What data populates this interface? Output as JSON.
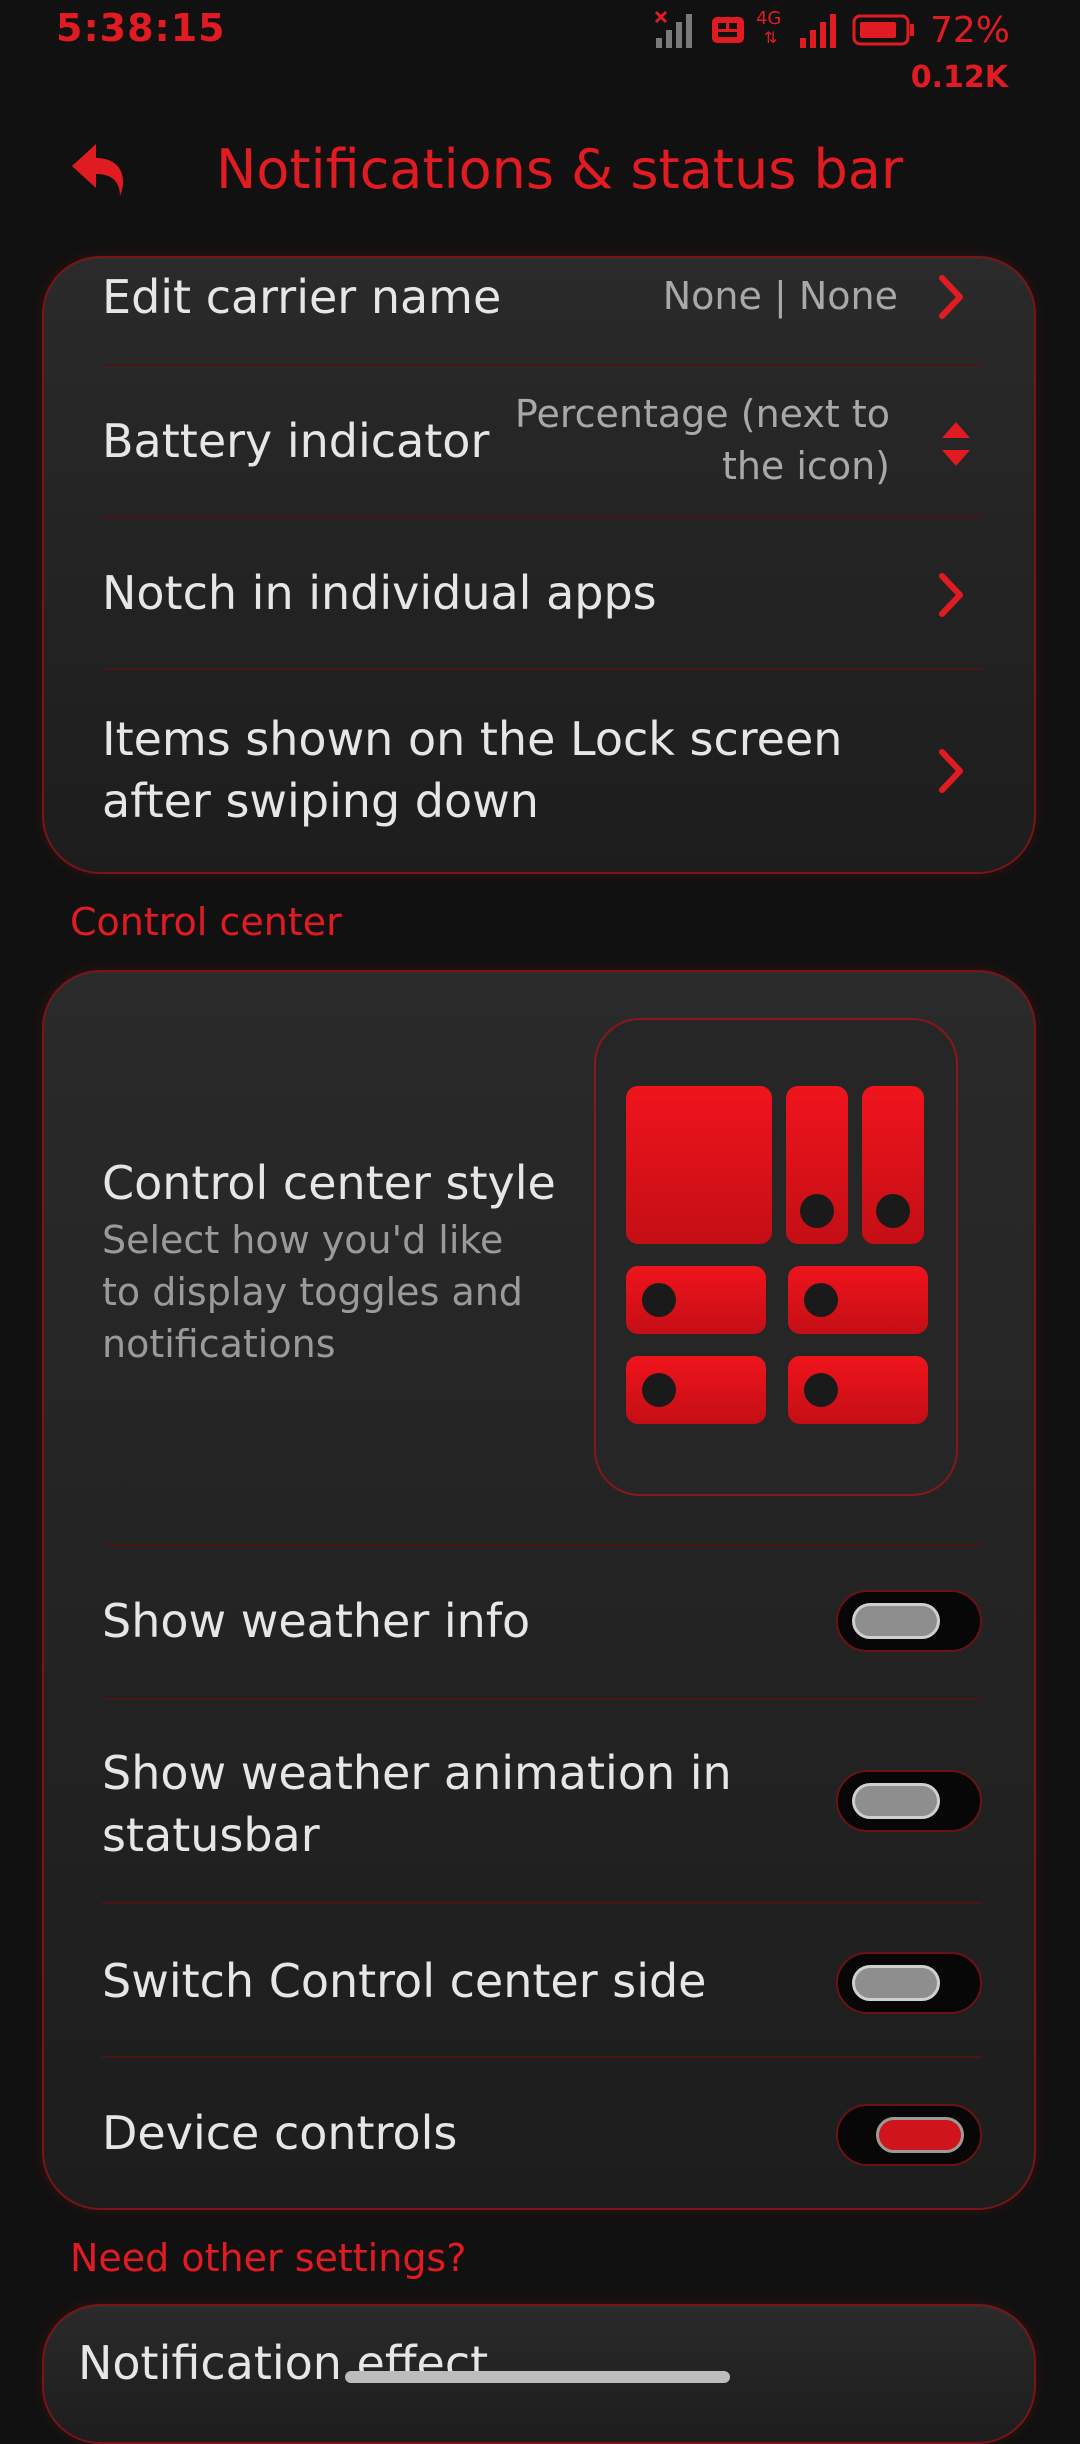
{
  "status_bar": {
    "time": "5:38:15",
    "battery_percent": "72%",
    "network_speed": "0.12K",
    "network_type": "4G"
  },
  "header": {
    "title": "Notifications & status bar"
  },
  "status_card": {
    "items": [
      {
        "label": "Edit carrier name",
        "value": "None | None",
        "control": "chevron"
      },
      {
        "label": "Battery indicator",
        "value_line1": "Percentage (next to",
        "value_line2": "the icon)",
        "control": "spinner"
      },
      {
        "label": "Notch in individual apps",
        "control": "chevron"
      },
      {
        "label_line1": "Items shown on the Lock screen",
        "label_line2": "after swiping down",
        "control": "chevron"
      }
    ]
  },
  "control_center": {
    "section_title": "Control center",
    "style_title": "Control center style",
    "style_desc_line1": "Select how you'd like",
    "style_desc_line2": "to display toggles and",
    "style_desc_line3": "notifications",
    "toggles": [
      {
        "label": "Show weather info",
        "on": false
      },
      {
        "label_line1": "Show weather animation in",
        "label_line2": "statusbar",
        "on": false
      },
      {
        "label": "Switch Control center side",
        "on": false
      },
      {
        "label": "Device controls",
        "on": true
      }
    ]
  },
  "other": {
    "section_title": "Need other settings?",
    "items": [
      {
        "label": "Notification effect"
      }
    ]
  },
  "colors": {
    "accent": "#e11b22",
    "background": "#111111",
    "card": "#242424",
    "text": "#e6e6e6",
    "secondary_text": "#a8a8a8"
  }
}
